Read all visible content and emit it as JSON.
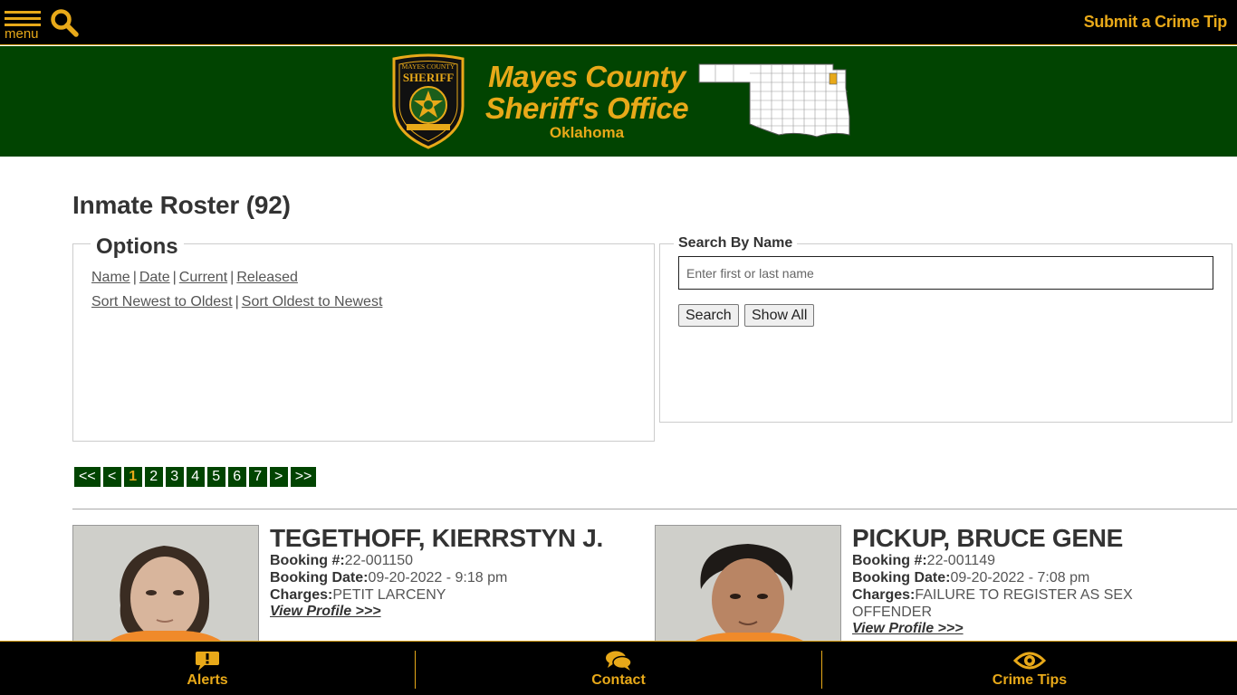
{
  "topbar": {
    "menu_label": "menu",
    "crime_tip_link": "Submit a Crime Tip"
  },
  "header": {
    "title_line1": "Mayes County",
    "title_line2": "Sheriff's Office",
    "state": "Oklahoma",
    "badge_text_top": "MAYES COUNTY",
    "badge_text_main": "SHERIFF"
  },
  "page": {
    "title": "Inmate Roster (92)"
  },
  "options": {
    "legend": "Options",
    "filters": [
      "Name",
      "Date",
      "Current",
      "Released"
    ],
    "sorts": [
      "Sort Newest to Oldest",
      "Sort Oldest to Newest"
    ]
  },
  "search": {
    "legend": "Search By Name",
    "placeholder": "Enter first or last name",
    "value": "",
    "search_button": "Search",
    "show_all_button": "Show All"
  },
  "pagination": {
    "items": [
      "<<",
      "<",
      "1",
      "2",
      "3",
      "4",
      "5",
      "6",
      "7",
      ">",
      ">>"
    ],
    "current": "1"
  },
  "inmates": [
    {
      "name": "TEGETHOFF, KIERRSTYN J.",
      "booking_label": "Booking #:",
      "booking_number": "22-001150",
      "date_label": "Booking Date:",
      "booking_date": "09-20-2022 - 9:18 pm",
      "charges_label": "Charges:",
      "charges": "PETIT LARCENY",
      "profile_link": "View Profile >>>"
    },
    {
      "name": "PICKUP, BRUCE GENE",
      "booking_label": "Booking #:",
      "booking_number": "22-001149",
      "date_label": "Booking Date:",
      "booking_date": "09-20-2022 - 7:08 pm",
      "charges_label": "Charges:",
      "charges": "FAILURE TO REGISTER AS SEX OFFENDER",
      "profile_link": "View Profile >>>"
    }
  ],
  "bottom_nav": {
    "alerts": "Alerts",
    "contact": "Contact",
    "crime_tips": "Crime Tips"
  },
  "colors": {
    "accent": "#e8a919",
    "banner_green": "#014401",
    "bar_black": "#000000"
  },
  "icons": [
    "menu-icon",
    "search-icon",
    "alert-icon",
    "chat-icon",
    "eye-icon",
    "sheriff-badge-icon",
    "oklahoma-map-icon"
  ]
}
